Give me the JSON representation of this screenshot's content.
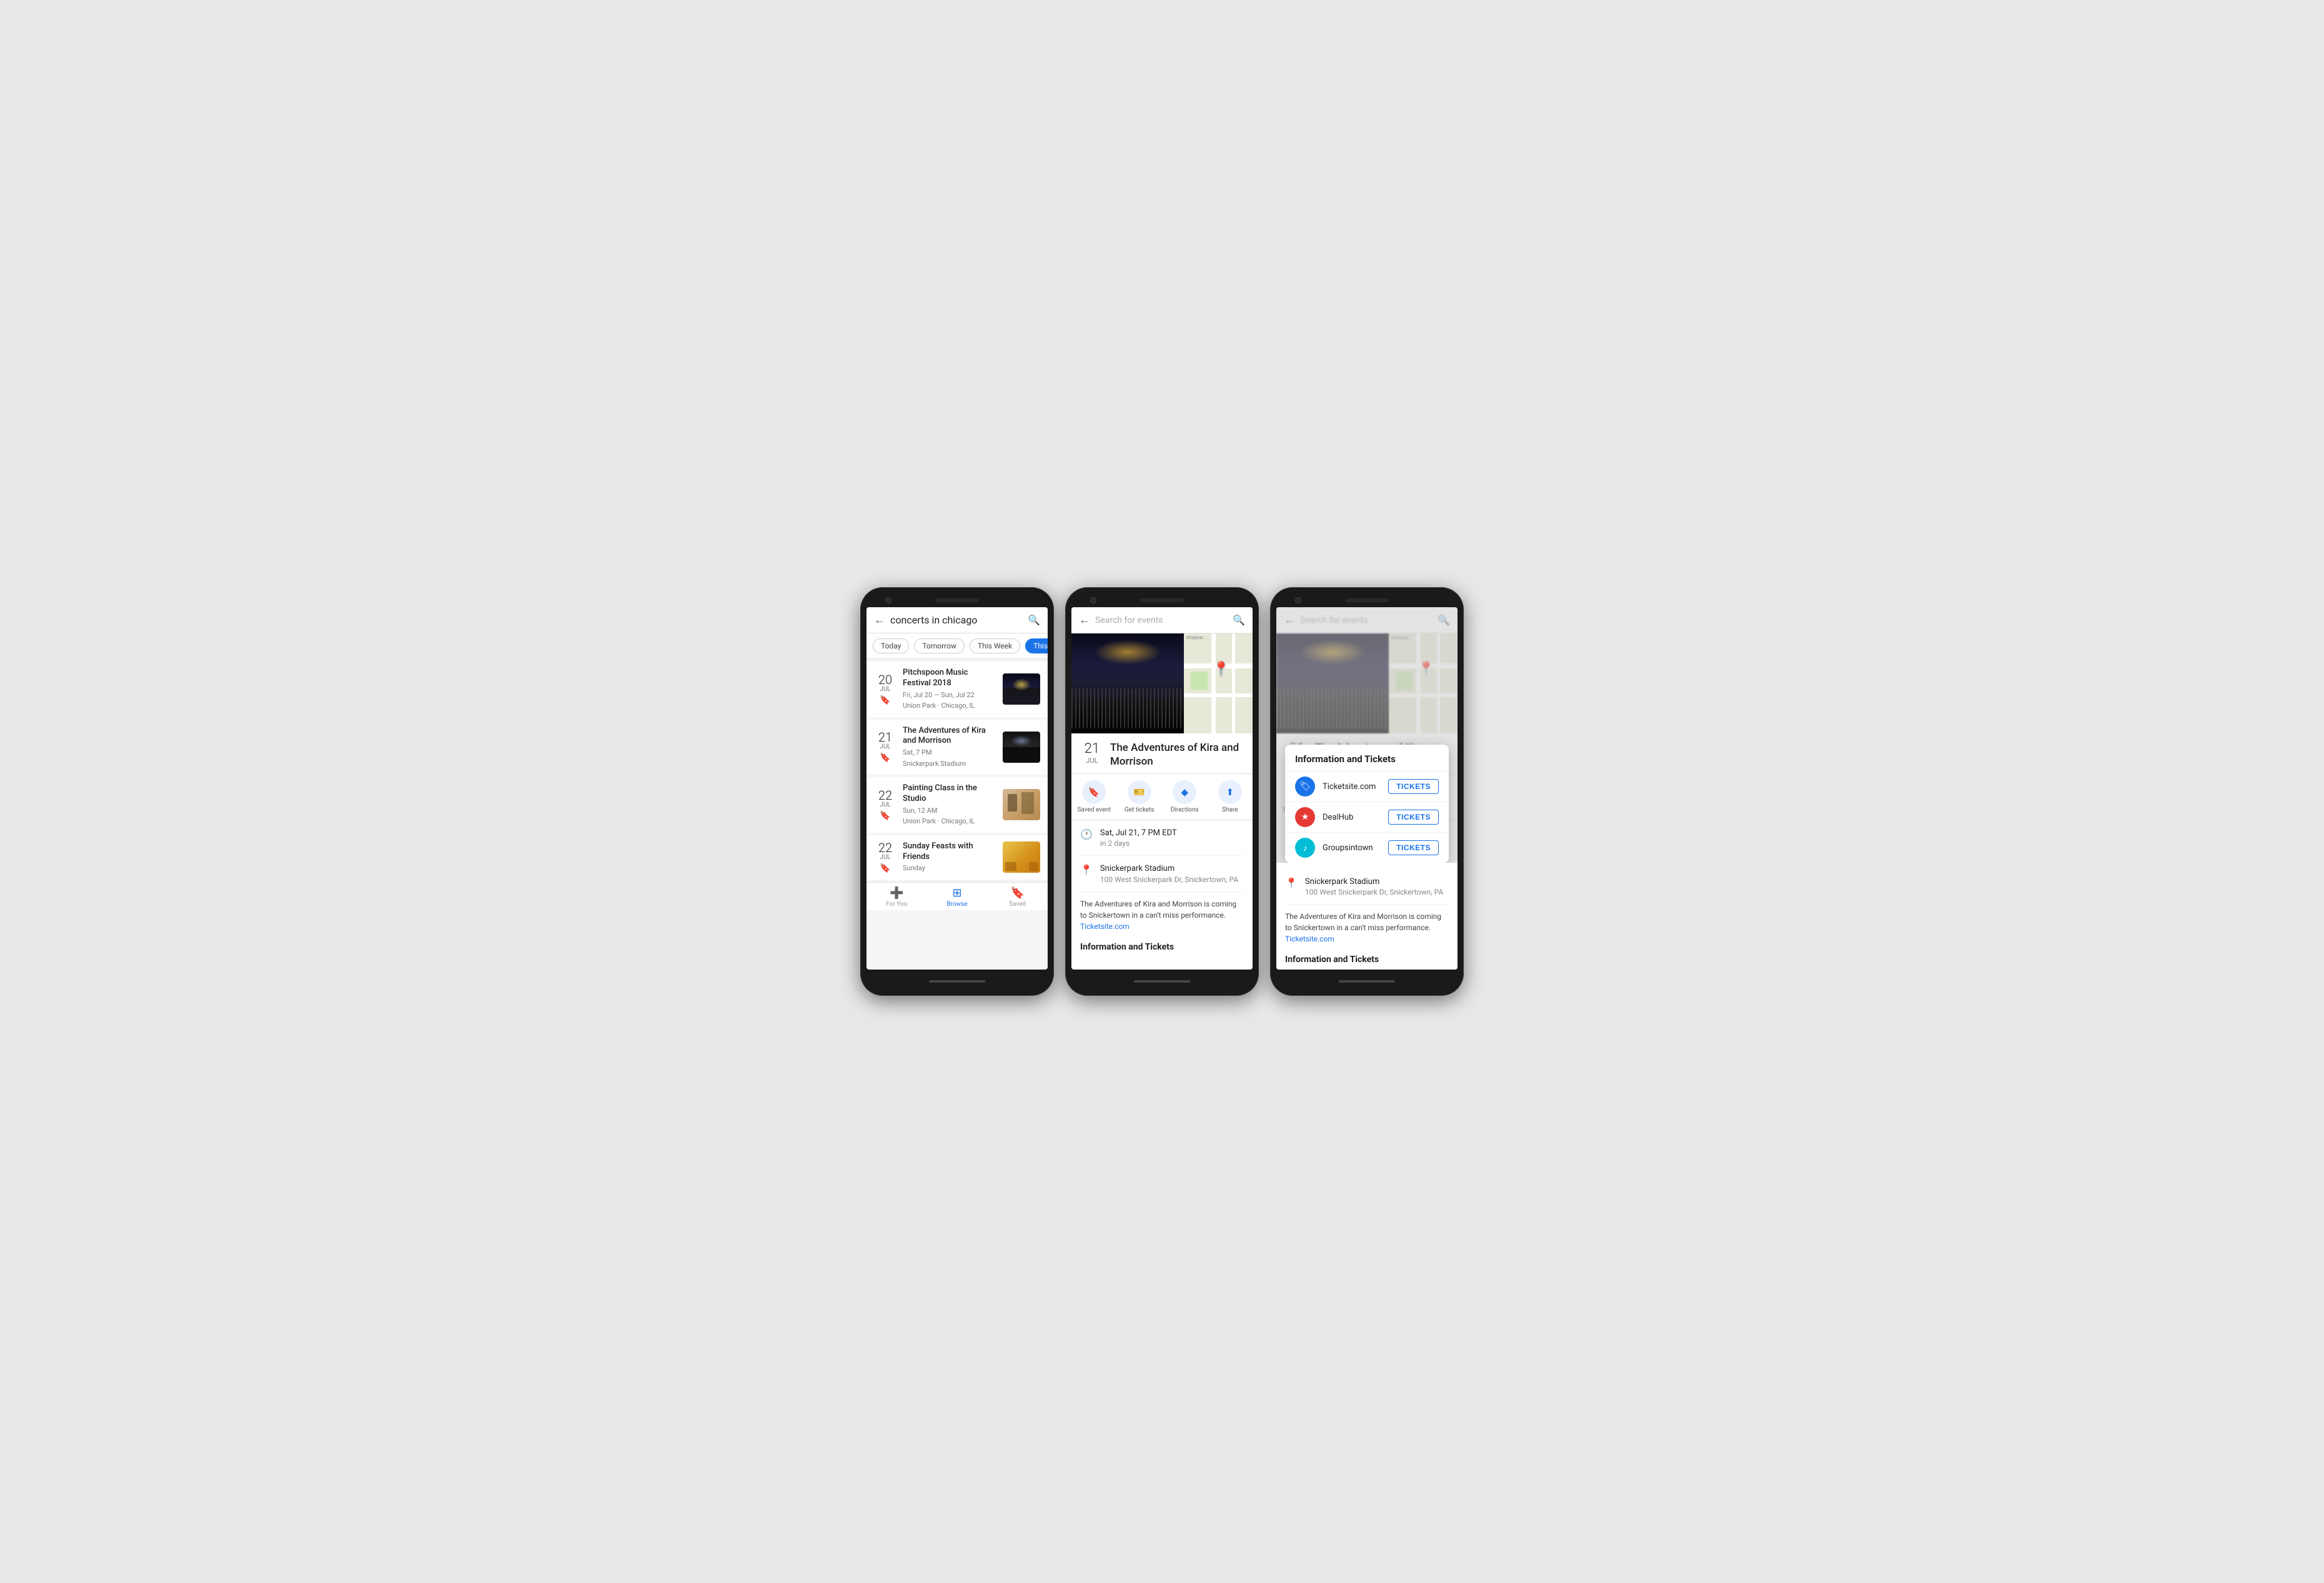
{
  "phone1": {
    "header": {
      "back_label": "←",
      "title": "concerts in chicago",
      "search_label": "🔍"
    },
    "chips": [
      {
        "label": "Today",
        "active": false
      },
      {
        "label": "Tomorrow",
        "active": false
      },
      {
        "label": "This Week",
        "active": false
      },
      {
        "label": "This Weekend",
        "active": true
      }
    ],
    "events": [
      {
        "date_num": "20",
        "date_month": "JUL",
        "name": "Pitchspoon Music Festival 2018",
        "sub1": "Fri, Jul 20 — Sun, Jul 22",
        "sub2": "Union Park · Chicago, IL",
        "thumb_type": "concert"
      },
      {
        "date_num": "21",
        "date_month": "JUL",
        "name": "The Adventures of Kira and Morrison",
        "sub1": "Sat, 7 PM",
        "sub2": "Snickerpark Stadium",
        "thumb_type": "concert2"
      },
      {
        "date_num": "22",
        "date_month": "JUL",
        "name": "Painting Class in the Studio",
        "sub1": "Sun, 12 AM",
        "sub2": "Union Park · Chicago, IL",
        "thumb_type": "painting"
      },
      {
        "date_num": "22",
        "date_month": "JUL",
        "name": "Sunday Feasts with Friends",
        "sub1": "Sunday",
        "sub2": "",
        "thumb_type": "food"
      }
    ],
    "nav": [
      {
        "label": "For You",
        "icon": "➕",
        "active": false
      },
      {
        "label": "Browse",
        "icon": "⊞",
        "active": true
      },
      {
        "label": "Saved",
        "icon": "🔖",
        "active": false
      }
    ]
  },
  "phone2": {
    "header": {
      "back_label": "←",
      "placeholder": "Search for events",
      "search_label": "🔍"
    },
    "event": {
      "date_num": "21",
      "date_month": "JUL",
      "title": "The Adventures of Kira and Morrison"
    },
    "actions": [
      {
        "label": "Saved event",
        "icon": "🔖",
        "color": "#1a73e8"
      },
      {
        "label": "Get tickets",
        "icon": "🎫",
        "color": "#1a73e8"
      },
      {
        "label": "Directions",
        "icon": "◆",
        "color": "#1a73e8"
      },
      {
        "label": "Share",
        "icon": "⬆",
        "color": "#1a73e8"
      }
    ],
    "time": {
      "main": "Sat, Jul 21, 7 PM EDT",
      "sub": "in 2 days"
    },
    "venue": {
      "main": "Snickerpark Stadium",
      "sub": "100 West Snickerpark Dr, Snickertown, PA"
    },
    "description": "The Adventures of Kira and Morrison is coming to Snickertown in a can't miss performance.",
    "description_link": "Ticketsite.com",
    "section_title": "Information and Tickets"
  },
  "phone3": {
    "header": {
      "back_label": "←",
      "placeholder": "Search for events",
      "search_label": "🔍"
    },
    "popup": {
      "title": "Information and Tickets",
      "tickets": [
        {
          "site": "Ticketsite.com",
          "color": "blue",
          "icon": "🏷"
        },
        {
          "site": "DealHub",
          "color": "red",
          "icon": "★"
        },
        {
          "site": "Groupsintown",
          "color": "teal",
          "icon": "♪"
        }
      ],
      "button_label": "TICKETS"
    },
    "venue": {
      "main": "Snickerpark Stadium",
      "sub": "100 West Snickerpark Dr, Snickertown, PA"
    },
    "description": "The Adventures of Kira and Morrison is coming to Snickertown in a can't miss performance.",
    "description_link": "Ticketsite.com",
    "section_title": "Information and Tickets"
  }
}
